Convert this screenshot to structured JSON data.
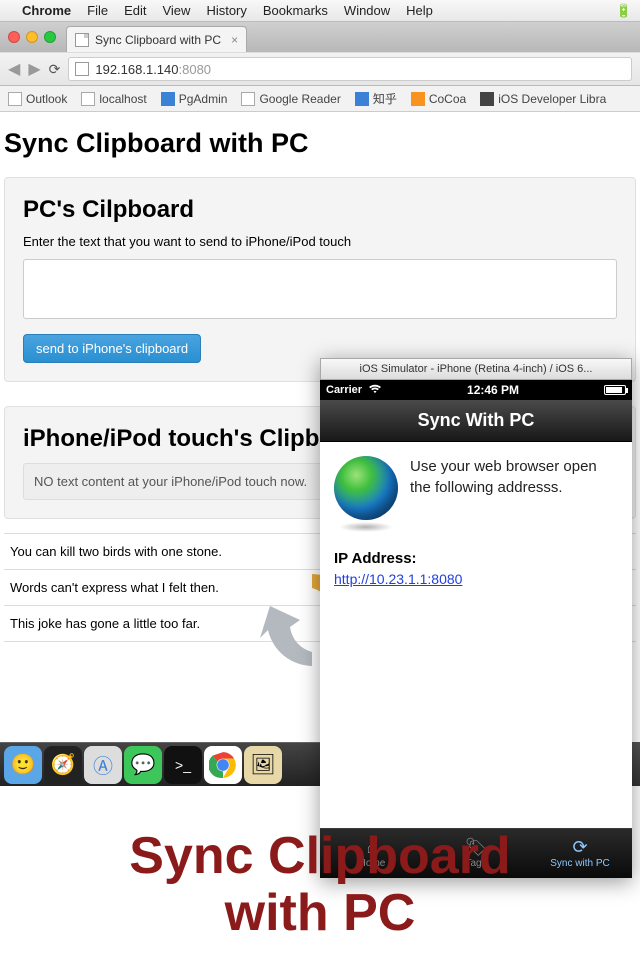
{
  "menubar": {
    "app": "Chrome",
    "items": [
      "File",
      "Edit",
      "View",
      "History",
      "Bookmarks",
      "Window",
      "Help"
    ]
  },
  "tab": {
    "title": "Sync Clipboard with PC"
  },
  "address": {
    "host": "192.168.1.140",
    "port": ":8080"
  },
  "bookmarks": [
    "Outlook",
    "localhost",
    "PgAdmin",
    "Google Reader",
    "知乎",
    "CoCoa",
    "iOS Developer Libra"
  ],
  "page": {
    "title": "Sync Clipboard with PC",
    "pc": {
      "heading": "PC's Cilpboard",
      "prompt": "Enter the text that you want to send to iPhone/iPod touch",
      "button": "send to iPhone's clipboard"
    },
    "phone": {
      "heading": "iPhone/iPod touch's Clipboard",
      "empty": "NO text content at your iPhone/iPod touch now."
    },
    "history": [
      "You can kill two birds with one stone.",
      "Words can't express what I felt then.",
      "This joke has gone a little too far."
    ]
  },
  "sim": {
    "window_title": "iOS Simulator - iPhone (Retina 4-inch) / iOS 6...",
    "carrier": "Carrier",
    "time": "12:46 PM",
    "nav_title": "Sync With PC",
    "body_text": "Use your web browser open the following addresss.",
    "ip_label": "IP Address:",
    "ip_url": "http://10.23.1.1:8080",
    "tabs": {
      "home": "Home",
      "tags": "Tags",
      "sync": "Sync with PC"
    }
  },
  "caption_line1": "Sync Clipboard",
  "caption_line2": "with PC"
}
